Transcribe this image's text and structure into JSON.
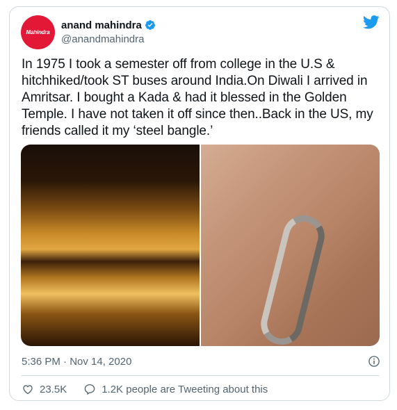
{
  "author": {
    "display_name": "anand mahindra",
    "handle": "@anandmahindra",
    "avatar_text": "Mahindra",
    "verified": true
  },
  "tweet": {
    "text": "In 1975 I took a semester off from college in the U.S &\nhitchhiked/took ST buses around India.On Diwali I arrived in\nAmritsar. I bought a Kada & had it blessed in the Golden\nTemple. I have not taken it off since then..Back in the US, my\nfriends called it my ‘steel bangle.’",
    "timestamp": "5:36 PM · Nov 14, 2020",
    "media": [
      "golden-temple-photo",
      "steel-bangle-photo"
    ]
  },
  "engagement": {
    "likes": "23.5K",
    "replies_text": "1.2K people are Tweeting about this"
  },
  "colors": {
    "brand_blue": "#1d9bf0",
    "mahindra_red": "#e31837",
    "muted_text": "#536471",
    "border": "#cfd9de"
  }
}
